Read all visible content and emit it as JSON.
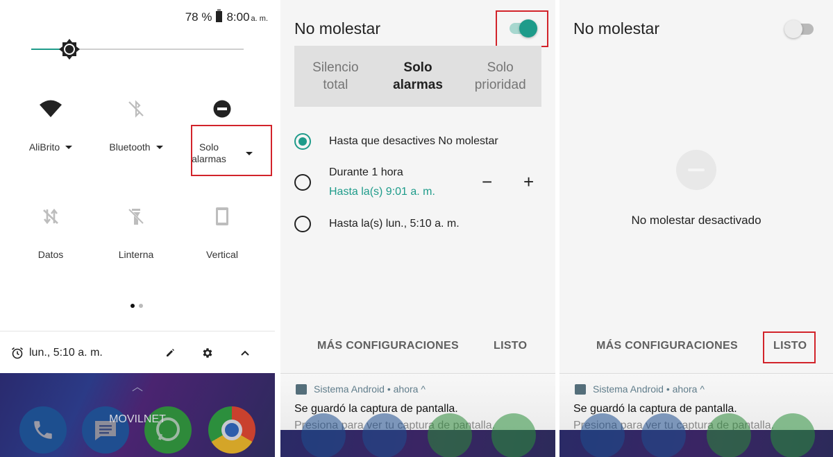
{
  "quick_settings": {
    "status_bar": {
      "battery": "78 %",
      "time": "8:00",
      "ampm": "a. m."
    },
    "brightness_level": 0.18,
    "tiles": [
      {
        "label": "AliBrito",
        "icon": "wifi-icon",
        "has_dropdown": true
      },
      {
        "label": "Bluetooth",
        "icon": "bluetooth-off-icon",
        "has_dropdown": true
      },
      {
        "label": "Solo\nalarmas",
        "label_line1": "Solo",
        "label_line2": "alarmas",
        "icon": "do-not-disturb-icon",
        "has_dropdown": true,
        "highlighted": true
      },
      {
        "label": "Datos",
        "icon": "mobile-data-off-icon"
      },
      {
        "label": "Linterna",
        "icon": "flashlight-off-icon"
      },
      {
        "label": "Vertical",
        "icon": "portrait-rotation-icon"
      }
    ],
    "page_indicator": {
      "current": 1,
      "total": 2
    },
    "footer": {
      "alarm": "lun., 5:10 a. m.",
      "icons": [
        "alarm-icon",
        "edit-icon",
        "settings-icon",
        "collapse-icon"
      ]
    },
    "home": {
      "carrier": "MOVILNET",
      "apps": [
        "phone-icon",
        "messages-icon",
        "whatsapp-icon",
        "chrome-icon"
      ]
    }
  },
  "dnd_on": {
    "title": "No molestar",
    "toggle_on": true,
    "segments": [
      {
        "line1": "Silencio",
        "line2": "total",
        "active": false
      },
      {
        "line1": "Solo",
        "line2": "alarmas",
        "active": true
      },
      {
        "line1": "Solo",
        "line2": "prioridad",
        "active": false
      }
    ],
    "options": [
      {
        "label": "Hasta que desactives No molestar",
        "selected": true
      },
      {
        "label": "Durante 1 hora",
        "sub": "Hasta la(s) 9:01 a. m.",
        "selected": false,
        "decrement": "−",
        "increment": "+"
      },
      {
        "label": "Hasta la(s) lun., 5:10 a. m.",
        "selected": false
      }
    ],
    "more_settings": "MÁS CONFIGURACIONES",
    "done": "LISTO"
  },
  "dnd_off": {
    "title": "No molestar",
    "toggle_on": false,
    "status": "No molestar desactivado",
    "more_settings": "MÁS CONFIGURACIONES",
    "done": "LISTO"
  },
  "notification": {
    "app": "Sistema Android",
    "separator": "•",
    "time": "ahora",
    "title": "Se guardó la captura de pantalla.",
    "text": "Presiona para ver tu captura de pantalla."
  },
  "colors": {
    "accent": "#1e9b8a",
    "highlight": "#d2232a"
  }
}
